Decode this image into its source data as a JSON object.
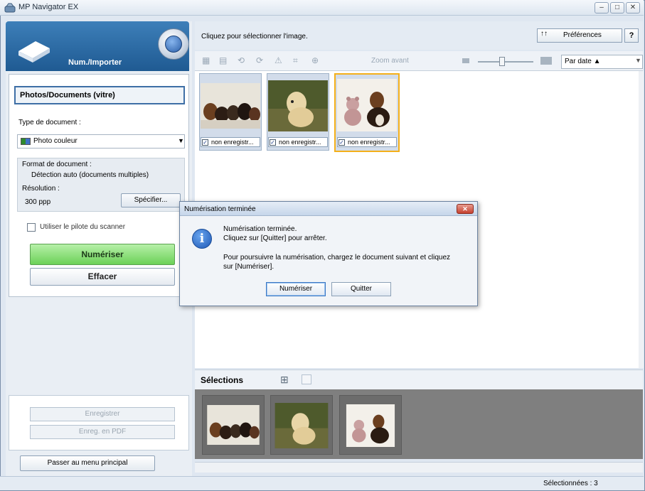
{
  "window": {
    "title": "MP Navigator EX",
    "controls": [
      "minimize-icon",
      "maximize-icon",
      "close-icon"
    ]
  },
  "left_panel": {
    "mode_title": "Num./Importer",
    "source_button": "Photos/Documents (vitre)",
    "document_type_label": "Type de document :",
    "document_type_value": "Photo couleur",
    "format_label": "Format de document :",
    "format_value": "Détection auto (documents multiples)",
    "resolution_label": "Résolution :",
    "resolution_value": "300 ppp",
    "specify_label": "Spécifier...",
    "driver_checkbox_label": "Utiliser le pilote du scanner",
    "driver_checked": false,
    "scan_label": "Numériser",
    "clear_label": "Effacer",
    "save_label": "Enregistrer",
    "save_pdf_label": "Enreg. en PDF",
    "main_menu_label": "Passer au menu principal"
  },
  "right_panel": {
    "instruction": "Cliquez pour sélectionner l'image.",
    "preferences_label": "Préférences",
    "help_label": "?",
    "zoom_label": "Zoom avant",
    "sort_label": "Par date ▲",
    "thumbnails": [
      {
        "label": "non enregistr...",
        "checked": true,
        "selected": false,
        "image": "dogs-group-photo"
      },
      {
        "label": "non enregistr...",
        "checked": true,
        "selected": false,
        "image": "yellow-dog-photo"
      },
      {
        "label": "non enregistr...",
        "checked": true,
        "selected": true,
        "image": "teddy-bear-dog-photo"
      }
    ],
    "selections_label": "Sélections",
    "status_text": "Sélectionnées : 3"
  },
  "dialog": {
    "title": "Numérisation terminée",
    "line1": "Numérisation terminée.",
    "line2": "Cliquez sur [Quitter] pour arrêter.",
    "line3": "Pour poursuivre la numérisation, chargez le document suivant et cliquez",
    "line4": "sur [Numériser].",
    "scan_button": "Numériser",
    "quit_button": "Quitter"
  },
  "colors": {
    "accent_blue": "#2b67a8",
    "scan_green": "#6cd158",
    "selection_orange": "#f4b01a"
  }
}
